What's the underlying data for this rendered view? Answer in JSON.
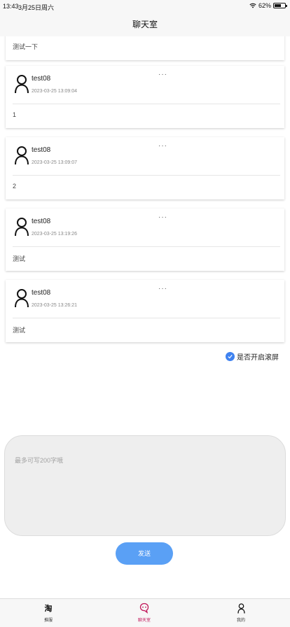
{
  "status_bar": {
    "time": "13:43",
    "date": "3月25日周六",
    "battery_text": "62%",
    "battery_level": 0.62
  },
  "nav": {
    "title": "聊天室"
  },
  "feed": {
    "partial_message": {
      "content": "测试一下"
    },
    "messages": [
      {
        "user": "test08",
        "time": "2023-03-25 13:09:04",
        "content": "1",
        "more": "···"
      },
      {
        "user": "test08",
        "time": "2023-03-25 13:09:07",
        "content": "2",
        "more": "···"
      },
      {
        "user": "test08",
        "time": "2023-03-25 13:19:26",
        "content": "测试",
        "more": "···"
      },
      {
        "user": "test08",
        "time": "2023-03-25 13:26:21",
        "content": "测试",
        "more": "···"
      }
    ]
  },
  "scroll_toggle": {
    "label": "是否开启滚屏",
    "checked": true,
    "color": "#3f82f0"
  },
  "composer": {
    "placeholder": "最多可写200字哦",
    "value": ""
  },
  "send_button": {
    "label": "发送",
    "color": "#5aa0f5"
  },
  "tabs": [
    {
      "label": "推服",
      "icon": "taobao-logo-icon",
      "glyph": "淘",
      "active": false
    },
    {
      "label": "聊天室",
      "icon": "chat-bubble-icon",
      "active": true
    },
    {
      "label": "我的",
      "icon": "user-icon",
      "active": false
    }
  ],
  "colors": {
    "active_tab": "#c2185b"
  }
}
